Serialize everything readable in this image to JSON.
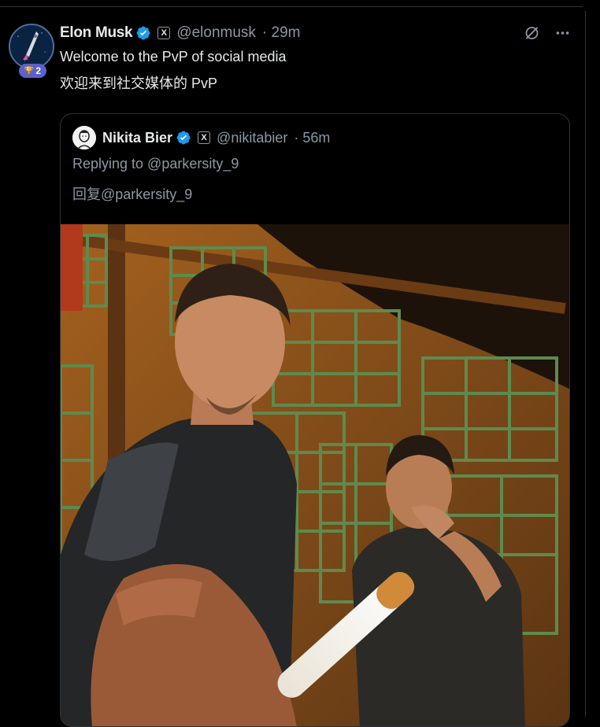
{
  "post": {
    "author_name": "Elon Musk",
    "handle": "@elonmusk",
    "time": "· 29m",
    "badge_count": "2",
    "text_line1": "Welcome to the PvP of social media",
    "text_line2": "欢迎来到社交媒体的 PvP",
    "x_badge": "X",
    "icons": [
      "verified-icon",
      "x-affiliate-icon",
      "grok-icon",
      "more-icon",
      "trophy-icon"
    ]
  },
  "quote": {
    "author_name": "Nikita Bier",
    "handle": "@nikitabier",
    "time": "· 56m",
    "replying_to": "Replying to @parkersity_9",
    "replying_to_translated": "回复@parkersity_9",
    "x_badge": "X"
  },
  "colors": {
    "background": "#000000",
    "text": "#e7e9ea",
    "secondary_text": "#8b98a5",
    "verified_blue": "#1d9bf0",
    "border": "#2f3336",
    "badge_purple": "#5a62c9"
  }
}
